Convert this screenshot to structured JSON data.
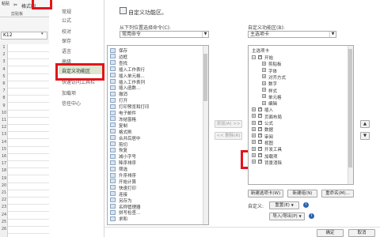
{
  "excel": {
    "ribbon_tab": "剪贴板",
    "format_painter": "格式刷",
    "namebox": "K12",
    "row_numbers": [
      "1",
      "2",
      "3",
      "4",
      "5",
      "6",
      "7",
      "8",
      "9",
      "10",
      "11",
      "12",
      "13",
      "14",
      "15",
      "16",
      "17",
      "18",
      "19",
      "20",
      "21",
      "22",
      "23",
      "24",
      "25",
      "26"
    ]
  },
  "nav": {
    "items": [
      {
        "label": "常规"
      },
      {
        "label": "公式"
      },
      {
        "label": "校对"
      },
      {
        "label": "保存"
      },
      {
        "label": "语言"
      },
      {
        "label": "高级"
      },
      {
        "label": "自定义功能区"
      },
      {
        "label": "快速访问工具栏"
      },
      {
        "label": "加载项"
      },
      {
        "label": "信任中心"
      }
    ]
  },
  "title": "自定义功能区。",
  "left": {
    "choose_label": "从下列位置选择命令(C):",
    "choose_value": "常用命令",
    "commands": [
      "保存",
      "边框",
      "查找",
      "插入工作表行",
      "插入单元格...",
      "插入工作表列",
      "插入函数...",
      "撤消",
      "打开",
      "打印预览和打印",
      "电子邮件",
      "冻结窗格",
      "复制",
      "格式刷",
      "合并后居中",
      "剪切",
      "恢复",
      "减小字号",
      "降序排序",
      "筛选",
      "升序排序",
      "开始计算",
      "快速打印",
      "连接",
      "另存为",
      "名称管理器",
      "拼写检查...",
      "求和"
    ]
  },
  "middle": {
    "add_button": "添加(A) >>",
    "remove_button": "<< 删除(R)"
  },
  "right": {
    "customize_label": "自定义功能区(B):",
    "customize_value": "主选项卡",
    "tree_header": "主选项卡",
    "tree": [
      {
        "label": "开始",
        "level": 0,
        "toggle": "−",
        "checked": true
      },
      {
        "label": "剪贴板",
        "level": 1,
        "toggle": "+"
      },
      {
        "label": "字体",
        "level": 1,
        "toggle": "+"
      },
      {
        "label": "对齐方式",
        "level": 1,
        "toggle": "+"
      },
      {
        "label": "数字",
        "level": 1,
        "toggle": "+"
      },
      {
        "label": "样式",
        "level": 1,
        "toggle": "+"
      },
      {
        "label": "单元格",
        "level": 1,
        "toggle": "+"
      },
      {
        "label": "编辑",
        "level": 1,
        "toggle": "+"
      },
      {
        "label": "插入",
        "level": 0,
        "toggle": "+",
        "checked": true
      },
      {
        "label": "页面布局",
        "level": 0,
        "toggle": "+",
        "checked": true
      },
      {
        "label": "公式",
        "level": 0,
        "toggle": "+",
        "checked": true
      },
      {
        "label": "数据",
        "level": 0,
        "toggle": "+",
        "checked": true
      },
      {
        "label": "审阅",
        "level": 0,
        "toggle": "+",
        "checked": true
      },
      {
        "label": "视图",
        "level": 0,
        "toggle": "+",
        "checked": true
      },
      {
        "label": "开发工具",
        "level": 0,
        "toggle": "+",
        "checked": true
      },
      {
        "label": "加载项",
        "level": 0,
        "toggle": "+",
        "checked": true
      },
      {
        "label": "背景消除",
        "level": 0,
        "toggle": "+",
        "checked": true
      }
    ],
    "new_tab_button": "新建选项卡(W)",
    "new_group_button": "新建组(N)",
    "rename_button": "重命名(M)...",
    "custom_label": "自定义:",
    "reset_button": "重置(E)",
    "import_export_button": "导入/导出(P)"
  },
  "footer": {
    "ok_button": "确定",
    "cancel_button": "取消"
  },
  "colors": {
    "highlight_box": "#e2141b",
    "nav_selected": "#dbe7d1"
  }
}
